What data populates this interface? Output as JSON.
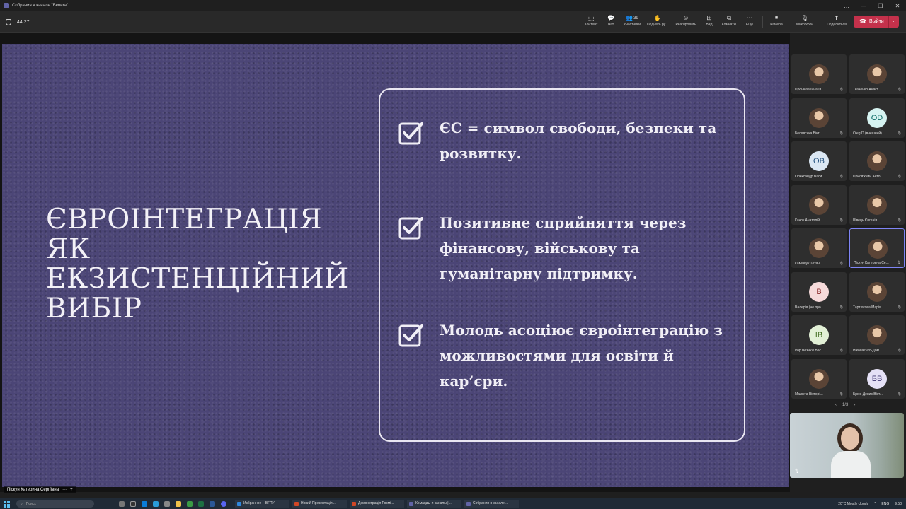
{
  "window": {
    "title": "Собрания в канале \"Benera\"",
    "controls": [
      "…",
      "—",
      "❐",
      "✕"
    ]
  },
  "toolbar": {
    "timer": "44:27",
    "buttons": [
      {
        "key": "content",
        "label": "Контент",
        "icon": "content-icon",
        "glyph": "⬚"
      },
      {
        "key": "chat",
        "label": "Чат",
        "icon": "chat-icon",
        "glyph": "💬"
      },
      {
        "key": "people",
        "label": "Участники",
        "icon": "people-icon",
        "glyph": "👥",
        "count": "39"
      },
      {
        "key": "raise",
        "label": "Поднять ру...",
        "icon": "raise-hand-icon",
        "glyph": "✋"
      },
      {
        "key": "react",
        "label": "Реагировать",
        "icon": "reaction-icon",
        "glyph": "☺"
      },
      {
        "key": "view",
        "label": "Вид",
        "icon": "view-icon",
        "glyph": "⊞"
      },
      {
        "key": "rooms",
        "label": "Комнаты",
        "icon": "breakout-rooms-icon",
        "glyph": "⧉"
      },
      {
        "key": "more",
        "label": "Еще",
        "icon": "more-icon",
        "glyph": "⋯"
      },
      {
        "key": "camera",
        "label": "Камера",
        "icon": "camera-icon",
        "glyph": "■"
      },
      {
        "key": "mic",
        "label": "Микрофон",
        "icon": "mic-off-icon",
        "glyph": "🎙"
      },
      {
        "key": "share",
        "label": "Поделиться",
        "icon": "share-icon",
        "glyph": "⬆"
      }
    ],
    "leave_label": "Выйти"
  },
  "slide": {
    "title_lines": [
      "ЄВРОІНТЕГРАЦІЯ",
      "ЯК",
      "ЕКЗИСТЕНЦІЙНИЙ",
      "ВИБІР"
    ],
    "points": [
      "ЄС = символ свободи, безпеки та розвитку.",
      "Позитивне сприйняття через фінансову, військову та гуманітарну підтримку.",
      "Молодь асоціює євроінтеграцію з можливостями для освіти й кар’єри."
    ],
    "colors": {
      "background": "#4b4576",
      "text": "#f1eff6"
    }
  },
  "participants": [
    {
      "name": "Пронюза Інна Ів...",
      "avatar": "photo"
    },
    {
      "name": "Ткаченко Анаст...",
      "avatar": "photo"
    },
    {
      "name": "Белявська Вікт...",
      "avatar": "photo"
    },
    {
      "name": "Oleg D (внешний)",
      "avatar": "initials",
      "initials": "OD",
      "bg": "#d6f3f1",
      "fg": "#0b6a64"
    },
    {
      "name": "Олександр Васи...",
      "avatar": "initials",
      "initials": "OB",
      "bg": "#dbe7f3",
      "fg": "#1e4d7b"
    },
    {
      "name": "Присяжний Анто...",
      "avatar": "photo"
    },
    {
      "name": "Качок Анатолій ...",
      "avatar": "photo"
    },
    {
      "name": "Швець Євгенія ...",
      "avatar": "photo"
    },
    {
      "name": "Камінчук Тетян...",
      "avatar": "photo"
    },
    {
      "name": "Піскун Катерина Се...",
      "avatar": "photo",
      "active": true
    },
    {
      "name": "Валерія (не про...",
      "avatar": "initials",
      "initials": "В",
      "bg": "#f6dada",
      "fg": "#8a2b2b"
    },
    {
      "name": "Тартюкова Марія...",
      "avatar": "photo"
    },
    {
      "name": "Ігор Вознюк Вас...",
      "avatar": "initials",
      "initials": "IB",
      "bg": "#e2f0d6",
      "fg": "#3f6a1e"
    },
    {
      "name": "Ніколаєнко-Дом...",
      "avatar": "photo"
    },
    {
      "name": "Малюта Вікторі...",
      "avatar": "photo"
    },
    {
      "name": "Брюс Денис Вікт...",
      "avatar": "initials",
      "initials": "БВ",
      "bg": "#e5e1f6",
      "fg": "#3f3773"
    }
  ],
  "pager": {
    "text": "1/3",
    "prev": "‹",
    "next": "›"
  },
  "presenter": {
    "name": "Піскун Катерина Сергіївна",
    "dots": "···",
    "plus": "+"
  },
  "taskbar": {
    "search_placeholder": "Поиск",
    "apps": [
      {
        "label": "Избранное – ВГПУ",
        "color": "#2f88e0"
      },
      {
        "label": "Новий Презентація...",
        "color": "#d24726"
      },
      {
        "label": "Демонстрація Розмі...",
        "color": "#d24726"
      },
      {
        "label": "Команды и каналы |...",
        "color": "#6264a7"
      },
      {
        "label": "Собрания в канале...",
        "color": "#6264a7"
      }
    ],
    "weather": "20°C  Mostly cloudy",
    "lang": "ENG",
    "time": "9:50"
  }
}
